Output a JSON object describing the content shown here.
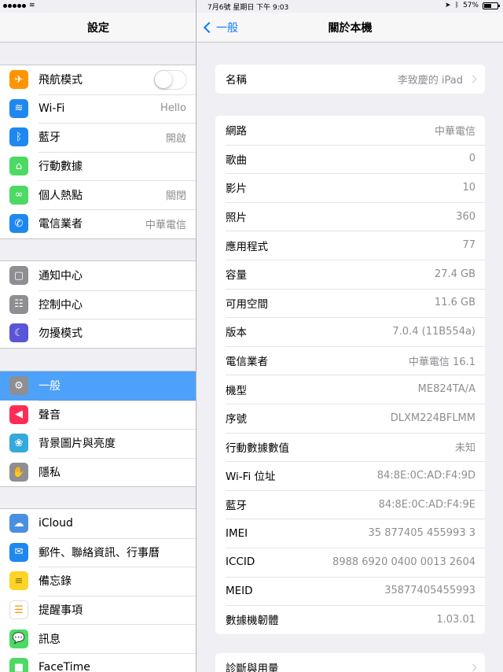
{
  "status_bar": {
    "time": "7月6號  星期日 下午 9:03",
    "battery": "57%",
    "battery_level": 0.57
  },
  "sidebar": {
    "title": "設定",
    "groups": [
      [
        {
          "label": "飛航模式",
          "value": "",
          "icon": "airplane-icon",
          "color": "#ff9500",
          "glyph": "✈",
          "toggle": true,
          "toggle_on": false
        },
        {
          "label": "Wi-Fi",
          "value": "Hello",
          "icon": "wifi-icon",
          "color": "#1e88f0",
          "glyph": "≋"
        },
        {
          "label": "藍牙",
          "value": "開啟",
          "icon": "bluetooth-icon",
          "color": "#1e88f0",
          "glyph": "ᛒ"
        },
        {
          "label": "行動數據",
          "value": "",
          "icon": "cellular-antenna-icon",
          "color": "#4cd964",
          "glyph": "⌂"
        },
        {
          "label": "個人熱點",
          "value": "關閉",
          "icon": "hotspot-link-icon",
          "color": "#4cd964",
          "glyph": "∞"
        },
        {
          "label": "電信業者",
          "value": "中華電信",
          "icon": "phone-icon",
          "color": "#1e88f0",
          "glyph": "✆"
        }
      ],
      [
        {
          "label": "通知中心",
          "value": "",
          "icon": "notification-center-icon",
          "color": "#8e8e93",
          "glyph": "▢"
        },
        {
          "label": "控制中心",
          "value": "",
          "icon": "control-center-icon",
          "color": "#8e8e93",
          "glyph": "☷"
        },
        {
          "label": "勿擾模式",
          "value": "",
          "icon": "moon-icon",
          "color": "#5856d6",
          "glyph": "☾"
        }
      ],
      [
        {
          "label": "一般",
          "value": "",
          "icon": "gear-icon",
          "color": "#8e8e93",
          "glyph": "⚙",
          "selected": true
        },
        {
          "label": "聲音",
          "value": "",
          "icon": "speaker-icon",
          "color": "#ff2d55",
          "glyph": "◀"
        },
        {
          "label": "背景圖片與亮度",
          "value": "",
          "icon": "wallpaper-flower-icon",
          "color": "#34aadc",
          "glyph": "❀"
        },
        {
          "label": "隱私",
          "value": "",
          "icon": "hand-icon",
          "color": "#8e8e93",
          "glyph": "✋"
        }
      ],
      [
        {
          "label": "iCloud",
          "value": "",
          "icon": "cloud-icon",
          "color": "#4a90e2",
          "glyph": "☁"
        },
        {
          "label": "郵件、聯絡資訊、行事曆",
          "value": "",
          "icon": "mail-icon",
          "color": "#1e88f0",
          "glyph": "✉"
        },
        {
          "label": "備忘錄",
          "value": "",
          "icon": "notes-icon",
          "color": "#ffd426",
          "glyph": "≡"
        },
        {
          "label": "提醒事項",
          "value": "",
          "icon": "reminders-list-icon",
          "color": "#ffffff",
          "glyph": "☰"
        },
        {
          "label": "訊息",
          "value": "",
          "icon": "messages-bubble-icon",
          "color": "#4cd964",
          "glyph": "💬"
        },
        {
          "label": "FaceTime",
          "value": "",
          "icon": "video-camera-icon",
          "color": "#4cd964",
          "glyph": "■"
        }
      ]
    ]
  },
  "detail": {
    "back_label": "一般",
    "title": "關於本機",
    "name_row": {
      "label": "名稱",
      "value": "李致慶的 iPad"
    },
    "rows": [
      {
        "label": "網路",
        "value": "中華電信"
      },
      {
        "label": "歌曲",
        "value": "0"
      },
      {
        "label": "影片",
        "value": "10"
      },
      {
        "label": "照片",
        "value": "360"
      },
      {
        "label": "應用程式",
        "value": "77"
      },
      {
        "label": "容量",
        "value": "27.4 GB"
      },
      {
        "label": "可用空間",
        "value": "11.6 GB"
      },
      {
        "label": "版本",
        "value": "7.0.4 (11B554a)"
      },
      {
        "label": "電信業者",
        "value": "中華電信 16.1"
      },
      {
        "label": "機型",
        "value": "ME824TA/A"
      },
      {
        "label": "序號",
        "value": "DLXM224BFLMM"
      },
      {
        "label": "行動數據數值",
        "value": "未知"
      },
      {
        "label": "Wi-Fi 位址",
        "value": "84:8E:0C:AD:F4:9D"
      },
      {
        "label": "藍牙",
        "value": "84:8E:0C:AD:F4:9E"
      },
      {
        "label": "IMEI",
        "value": "35 877405 455993 3"
      },
      {
        "label": "ICCID",
        "value": "8988 6920 0400 0013 2604"
      },
      {
        "label": "MEID",
        "value": "35877405455993"
      },
      {
        "label": "數據機韌體",
        "value": "1.03.01"
      }
    ],
    "diagnostics_label": "診斷與用量"
  },
  "colors": {
    "accent": "#0a7aff",
    "selected_row": "#4ea1f8"
  }
}
